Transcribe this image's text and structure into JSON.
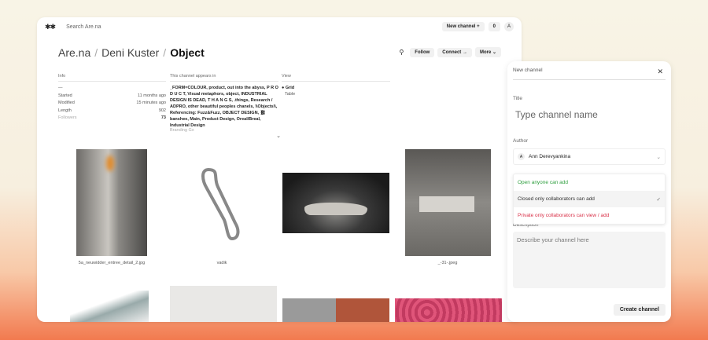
{
  "topbar": {
    "logo": "✱✱",
    "search_placeholder": "Search Are.na",
    "new_channel": "New channel +",
    "count": "0",
    "avatar": "A"
  },
  "breadcrumb": {
    "root": "Are.na",
    "user": "Deni Kuster",
    "channel": "Object",
    "sep": "/"
  },
  "actions": {
    "search_icon": "search-icon",
    "follow": "Follow",
    "connect": "Connect →",
    "more": "More ⌄"
  },
  "info": {
    "header": "Info",
    "dash": "—",
    "rows": [
      {
        "k": "Started",
        "v": "11 months ago"
      },
      {
        "k": "Modified",
        "v": "15 minutes ago"
      },
      {
        "k": "Length",
        "v": "902"
      },
      {
        "k": "Followers",
        "v": "73"
      }
    ]
  },
  "appears": {
    "header": "This channel appears in",
    "text": "_FORM=COLOUR, product, out into the abyss, P R O D U C T, Visual metaphors, object, INDUSTRIAL DESIGN IS DEAD, T H A N G S, .things, Research / ADPRO, other beautiful peoples chanels, \\\\Objects\\\\, Referencing: Fuzz&Fuzz, OBJECT DESIGN, ⛓banshee, Main, Product Design, Oreal/Breal, Industrial Design",
    "more": "Branding Gx",
    "expand": "⌄"
  },
  "view": {
    "header": "View",
    "options": [
      "● Grid",
      "Table"
    ]
  },
  "grid": {
    "captions": [
      "5a_neuwidder_entree_detail_2.jpg",
      "vadik",
      "",
      "_-31-.jpeg"
    ]
  },
  "modal": {
    "title": "New channel",
    "close": "✕",
    "title_label": "Title",
    "title_placeholder": "Type channel name",
    "author_label": "Author",
    "author_avatar": "A",
    "author": "Ann Derevyankina",
    "options": [
      {
        "label": "Open anyone can add",
        "color": "#2e9e3e"
      },
      {
        "label": "Closed only collaborators can add",
        "color": "#333333",
        "check": "✓"
      },
      {
        "label": "Private only collaborators can view / add",
        "color": "#d9334a"
      }
    ],
    "desc_label": "Description",
    "desc_placeholder": "Describe your channel here",
    "create": "Create channel"
  }
}
